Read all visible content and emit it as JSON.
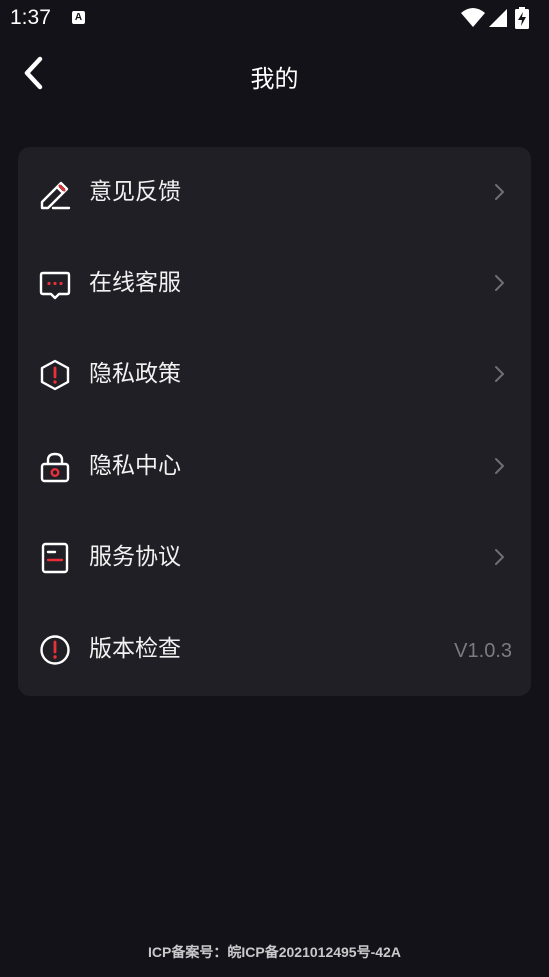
{
  "status_bar": {
    "time": "1:37",
    "notification_badge": "A"
  },
  "header": {
    "title": "我的"
  },
  "menu": {
    "items": [
      {
        "label": "意见反馈",
        "icon": "feedback-edit-icon",
        "action": "chevron"
      },
      {
        "label": "在线客服",
        "icon": "chat-bubble-icon",
        "action": "chevron"
      },
      {
        "label": "隐私政策",
        "icon": "shield-alert-icon",
        "action": "chevron"
      },
      {
        "label": "隐私中心",
        "icon": "lock-icon",
        "action": "chevron"
      },
      {
        "label": "服务协议",
        "icon": "document-icon",
        "action": "chevron"
      },
      {
        "label": "版本检查",
        "icon": "info-circle-icon",
        "value": "V1.0.3"
      }
    ]
  },
  "footer": {
    "icp": "ICP备案号：皖ICP备2021012495号-42A"
  },
  "colors": {
    "background": "#121218",
    "card": "#1f1f25",
    "accent_red": "#e8303a",
    "icon_white": "#ffffff",
    "chevron": "#6e6e75"
  }
}
